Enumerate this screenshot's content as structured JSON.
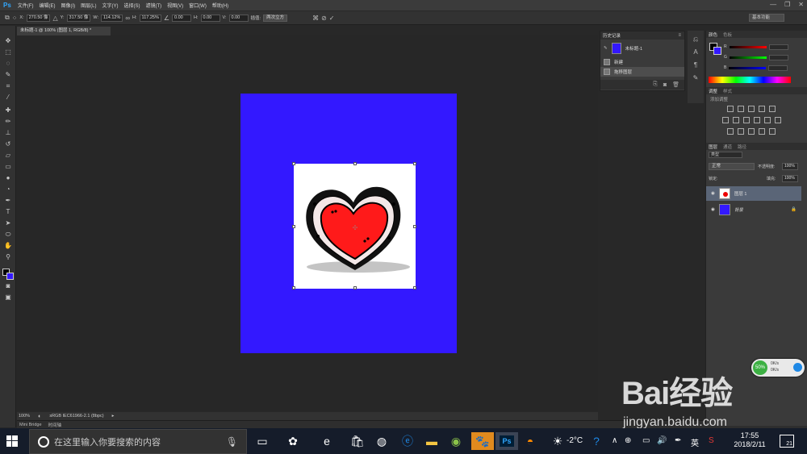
{
  "menubar": {
    "logo": "Ps",
    "items": [
      "文件(F)",
      "编辑(E)",
      "图像(I)",
      "图层(L)",
      "文字(Y)",
      "选择(S)",
      "滤镜(T)",
      "视图(V)",
      "窗口(W)",
      "帮助(H)"
    ]
  },
  "options": {
    "x_label": "X:",
    "x_value": "270.50 像",
    "y_label": "Y:",
    "y_value": "317.50 像",
    "w_label": "W:",
    "w_value": "114.12%",
    "h_label": "H:",
    "h_value": "117.25%",
    "angle_value": "0.00",
    "hskew_label": "H:",
    "hskew_value": "0.00",
    "vskew_label": "V:",
    "vskew_value": "0.00",
    "interp_label": "插值:",
    "interp_value": "两次立方",
    "workspace": "基本功能"
  },
  "document": {
    "tab_title": "未标题-1 @ 100% (图层 1, RGB/8) *",
    "canvas_color": "#3318ff"
  },
  "status": {
    "zoom": "100%",
    "profile": "sRGB IEC61966-2.1 (8bpc)",
    "tab_bridge": "Mini Bridge",
    "tab_timeline": "时间轴"
  },
  "history": {
    "title": "历史记录",
    "snapshot_name": "未标题-1",
    "items": [
      "新建",
      "拖移图层"
    ]
  },
  "color_panel": {
    "tab_color": "颜色",
    "tab_swatches": "色板",
    "r_label": "R",
    "g_label": "G",
    "b_label": "B",
    "fg_color": "#000000",
    "bg_color": "#3318ff"
  },
  "adjust_panel": {
    "tab_adjust": "调整",
    "tab_style": "样式",
    "hint": "添加调整"
  },
  "layers_panel": {
    "tab_layers": "图层",
    "tab_channels": "通道",
    "tab_paths": "路径",
    "kind_filter": "类型",
    "blend_mode": "正常",
    "opacity_label": "不透明度:",
    "opacity_value": "100%",
    "lock_label": "锁定:",
    "fill_label": "填充:",
    "fill_value": "100%",
    "layers": [
      {
        "name": "图层 1"
      },
      {
        "name": "背景"
      }
    ]
  },
  "net_widget": {
    "percent": "50%",
    "up": "0K/s",
    "down": "0K/s"
  },
  "taskbar": {
    "search_placeholder": "在这里输入你要搜索的内容",
    "weather": "-2°C",
    "ime": "英",
    "time": "17:55",
    "date": "2018/2/11",
    "notifications": "21"
  },
  "watermark": {
    "brand": "Bai经验",
    "url": "jingyan.baidu.com"
  }
}
